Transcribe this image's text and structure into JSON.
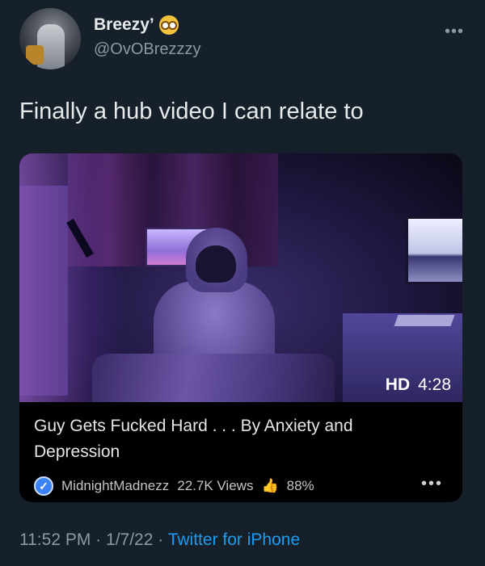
{
  "author": {
    "display_name": "Breezy’",
    "emoji": "flushed-face-icon",
    "handle": "@OvOBrezzzy"
  },
  "tweet": {
    "text": "Finally a hub video I can relate to"
  },
  "video_card": {
    "quality_badge": "HD",
    "duration": "4:28",
    "title": "Guy Gets Fucked Hard . . . By Anxiety and Depression",
    "channel": "MidnightMadnezz",
    "views": "22.7K Views",
    "rating": "88%"
  },
  "footer": {
    "time": "11:52 PM",
    "separator": "·",
    "date": "1/7/22",
    "source": "Twitter for iPhone"
  },
  "colors": {
    "background": "#15202b",
    "link_blue": "#1d9bf0",
    "muted": "#8b98a5",
    "verified": "#3b82f6"
  }
}
